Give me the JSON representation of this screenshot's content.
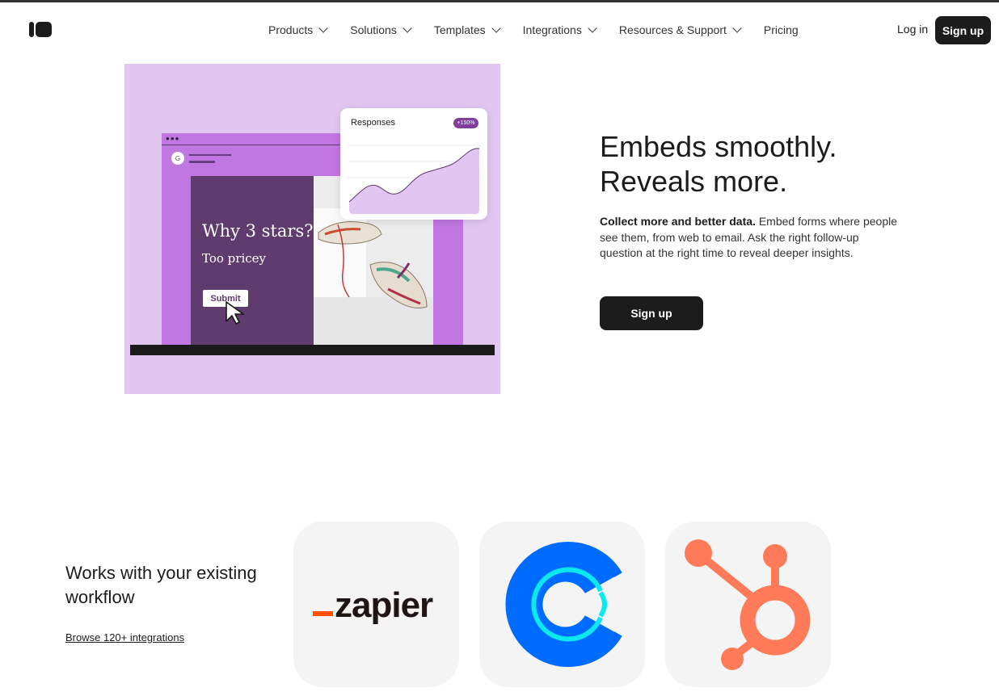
{
  "nav": {
    "items": [
      {
        "label": "Products",
        "has_menu": true
      },
      {
        "label": "Solutions",
        "has_menu": true
      },
      {
        "label": "Templates",
        "has_menu": true
      },
      {
        "label": "Integrations",
        "has_menu": true
      },
      {
        "label": "Resources & Support",
        "has_menu": true
      },
      {
        "label": "Pricing",
        "has_menu": false
      }
    ],
    "login": "Log in",
    "signup": "Sign up"
  },
  "illustration": {
    "avatar_letter": "G",
    "question": "Why 3 stars?",
    "answer": "Too pricey",
    "submit": "Submit",
    "card_title": "Responses",
    "card_badge": "+150%"
  },
  "hero": {
    "headline_1": "Embeds smoothly.",
    "headline_2": "Reveals more.",
    "lead_bold": "Collect more and better data.",
    "lead_rest": " Embed forms where people see them, from web to email. Ask the right follow-up question at the right time to reveal deeper insights.",
    "cta": "Sign up"
  },
  "integrations": {
    "title": "Works with your existing workflow",
    "link": "Browse 120+ integrations",
    "tiles": [
      {
        "name": "zapier",
        "wordmark": "zapier",
        "icon": "zapier-logo"
      },
      {
        "name": "calendly",
        "icon": "calendly-logo"
      },
      {
        "name": "hubspot",
        "icon": "hubspot-logo"
      }
    ]
  },
  "colors": {
    "ink": "#1c1c1c",
    "hero_bg": "#e1c6f1",
    "browser_purple": "#c177e2",
    "form_purple": "#5f3b6e",
    "zapier_orange": "#ff4f00",
    "calendly_blue": "#006bff",
    "calendly_cyan": "#0ae8f0",
    "hubspot_orange": "#ff7a59"
  }
}
